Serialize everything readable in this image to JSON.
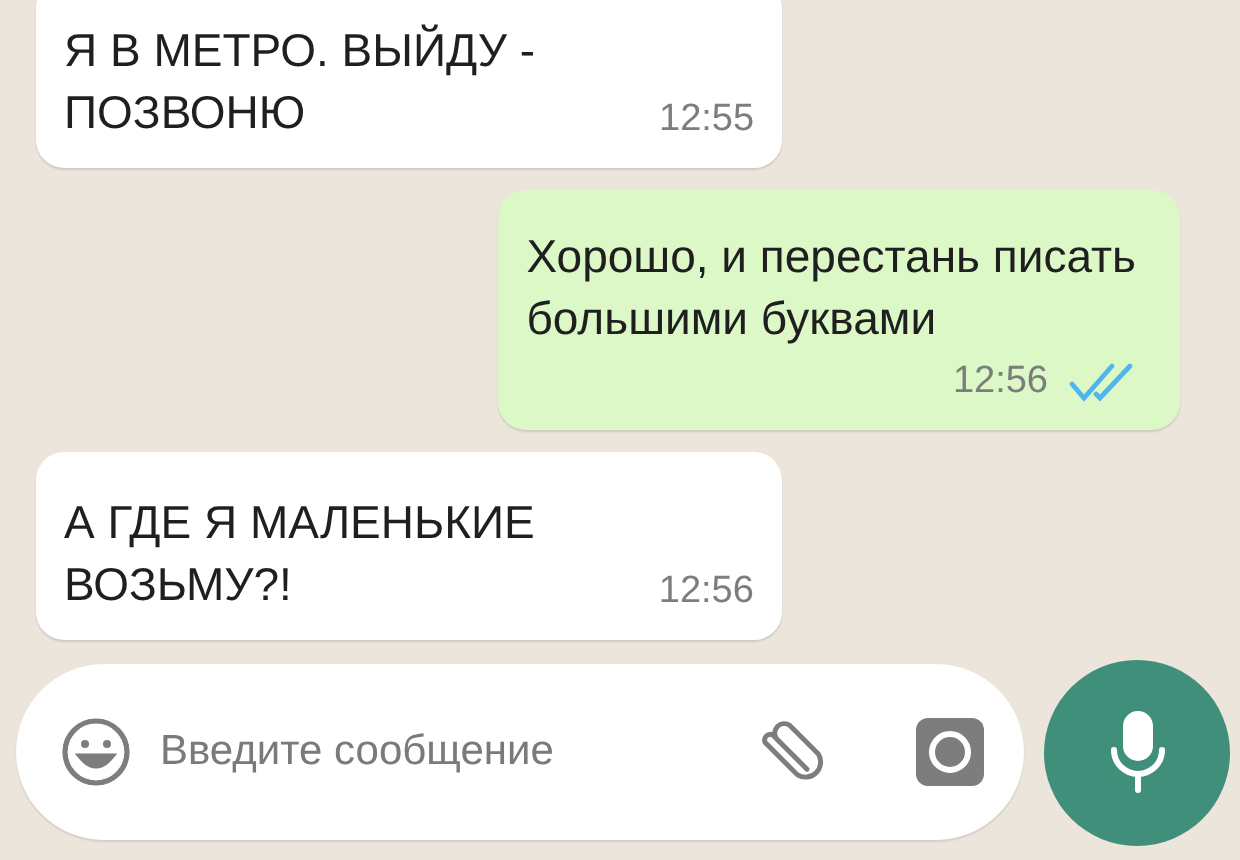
{
  "messages": [
    {
      "kind": "incoming",
      "text": "Я В МЕТРО. ВЫЙДУ -\nПОЗВОНЮ",
      "time": "12:55"
    },
    {
      "kind": "outgoing",
      "text": "Хорошо, и перестань писать\nбольшими буквами",
      "time": "12:56",
      "read": true
    },
    {
      "kind": "incoming",
      "text": "А ГДЕ Я МАЛЕНЬКИЕ\nВОЗЬМУ?!",
      "time": "12:56"
    }
  ],
  "composer": {
    "placeholder": "Введите сообщение"
  }
}
